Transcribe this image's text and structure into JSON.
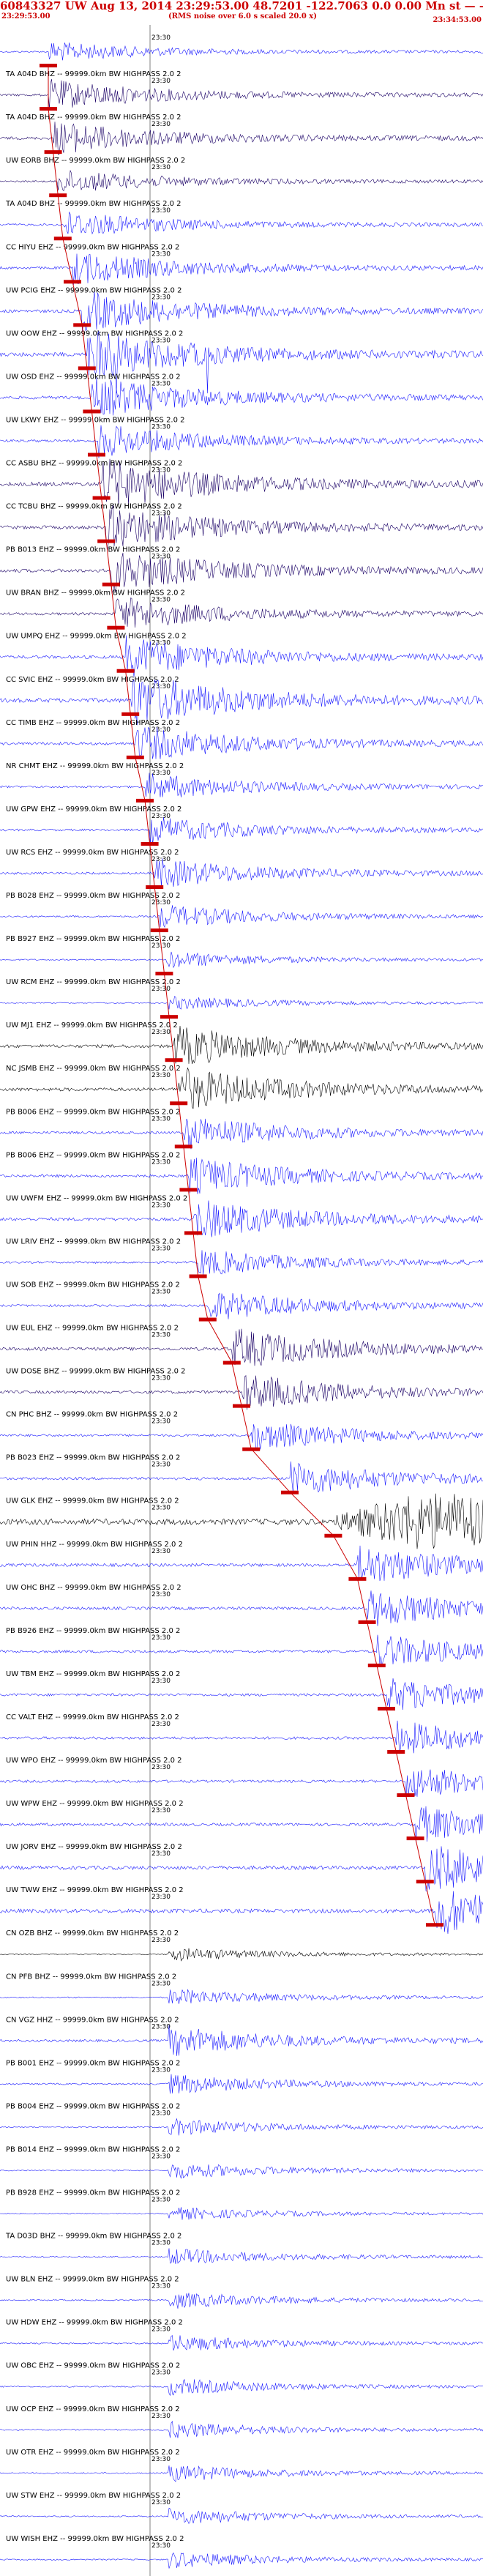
{
  "header": {
    "title": "60843327 UW Aug 13, 2014 23:29:53.00   48.7201  -122.7063   0.0 0.00  Mn st — — — — -1",
    "start_time": "23:29:53.00",
    "note": "(RMS noise over 6.0 s scaled 20.0 x)",
    "end_time": "23:34:53.00"
  },
  "time_mark": "23:30",
  "colors": {
    "accent": "#cc0000",
    "trace_blue": "#1a1aff",
    "trace_dark": "#1a0066",
    "trace_black": "#000000"
  },
  "traces": [
    {
      "label": "",
      "color": "blue",
      "amp": 0.6,
      "pick": 0.1
    },
    {
      "label": "TA A04D BHZ -- 99999.0km BW  HIGHPASS  2.0  2",
      "color": "dark",
      "amp": 0.9,
      "pick": 0.1
    },
    {
      "label": "TA A04D BHZ -- 99999.0km BW  HIGHPASS  2.0  2",
      "color": "dark",
      "amp": 1.0,
      "pick": 0.11
    },
    {
      "label": "UW EORB BHZ -- 99999.0km BW  HIGHPASS  2.0  2",
      "color": "dark",
      "amp": 0.7,
      "pick": 0.12
    },
    {
      "label": "TA A04D BHZ -- 99999.0km BW  HIGHPASS  2.0  2",
      "color": "blue",
      "amp": 0.8,
      "pick": 0.13
    },
    {
      "label": "CC HIYU EHZ -- 99999.0km BW  HIGHPASS  2.0  2",
      "color": "blue",
      "amp": 1.0,
      "pick": 0.15
    },
    {
      "label": "UW PCIG EHZ -- 99999.0km BW  HIGHPASS  2.0  2",
      "color": "blue",
      "amp": 1.2,
      "pick": 0.17
    },
    {
      "label": "UW OOW EHZ -- 99999.0km BW  HIGHPASS  2.0  2",
      "color": "blue",
      "amp": 1.5,
      "pick": 0.18,
      "spikes": true
    },
    {
      "label": "UW OSD EHZ -- 99999.0km BW  HIGHPASS  2.0  2",
      "color": "blue",
      "amp": 1.2,
      "pick": 0.19
    },
    {
      "label": "UW LKWY EHZ -- 99999.0km BW  HIGHPASS  2.0  2",
      "color": "blue",
      "amp": 1.0,
      "pick": 0.2
    },
    {
      "label": "CC ASBU BHZ -- 99999.0km BW  HIGHPASS  2.0  2",
      "color": "dark",
      "amp": 1.5,
      "pick": 0.21
    },
    {
      "label": "CC TCBU BHZ -- 99999.0km BW  HIGHPASS  2.0  2",
      "color": "dark",
      "amp": 1.3,
      "pick": 0.22
    },
    {
      "label": "PB B013 EHZ -- 99999.0km BW  HIGHPASS  2.0  2",
      "color": "dark",
      "amp": 1.3,
      "pick": 0.23
    },
    {
      "label": "UW BRAN BHZ -- 99999.0km BW  HIGHPASS  2.0  2",
      "color": "dark",
      "amp": 1.0,
      "pick": 0.24
    },
    {
      "label": "UW UMPQ EHZ -- 99999.0km BW  HIGHPASS  2.0  2",
      "color": "blue",
      "amp": 1.2,
      "pick": 0.26
    },
    {
      "label": "CC SVIC EHZ -- 99999.0km BW  HIGHPASS  2.0  2",
      "color": "blue",
      "amp": 1.6,
      "pick": 0.27
    },
    {
      "label": "CC TIMB EHZ -- 99999.0km BW  HIGHPASS  2.0  2",
      "color": "blue",
      "amp": 1.1,
      "pick": 0.28
    },
    {
      "label": "NR CHMT EHZ -- 99999.0km BW  HIGHPASS  2.0  2",
      "color": "blue",
      "amp": 0.8,
      "pick": 0.3
    },
    {
      "label": "UW GPW EHZ -- 99999.0km BW  HIGHPASS  2.0  2",
      "color": "blue",
      "amp": 0.8,
      "pick": 0.31
    },
    {
      "label": "UW RCS EHZ -- 99999.0km BW  HIGHPASS  2.0  2",
      "color": "blue",
      "amp": 0.9,
      "pick": 0.32
    },
    {
      "label": "PB B028 EHZ -- 99999.0km BW  HIGHPASS  2.0  2",
      "color": "blue",
      "amp": 0.7,
      "pick": 0.33
    },
    {
      "label": "PB B927 EHZ -- 99999.0km BW  HIGHPASS  2.0  2",
      "color": "blue",
      "amp": 0.5,
      "pick": 0.34
    },
    {
      "label": "UW RCM EHZ -- 99999.0km BW  HIGHPASS  2.0  2",
      "color": "blue",
      "amp": 0.4,
      "pick": 0.35
    },
    {
      "label": "UW MJ1 EHZ -- 99999.0km BW  HIGHPASS  2.0  2",
      "color": "black",
      "amp": 1.2,
      "pick": 0.36
    },
    {
      "label": "NC JSMB EHZ -- 99999.0km BW  HIGHPASS  2.0  2",
      "color": "black",
      "amp": 1.3,
      "pick": 0.37
    },
    {
      "label": "PB B006 EHZ -- 99999.0km BW  HIGHPASS  2.0  2",
      "color": "blue",
      "amp": 1.0,
      "pick": 0.38
    },
    {
      "label": "PB B006 EHZ -- 99999.0km BW  HIGHPASS  2.0  2",
      "color": "blue",
      "amp": 1.1,
      "pick": 0.39
    },
    {
      "label": "UW UWFM EHZ -- 99999.0km BW  HIGHPASS  2.0  2",
      "color": "blue",
      "amp": 1.2,
      "pick": 0.4
    },
    {
      "label": "UW LRIV EHZ -- 99999.0km BW  HIGHPASS  2.0  2",
      "color": "blue",
      "amp": 0.8,
      "pick": 0.41
    },
    {
      "label": "UW SOB EHZ -- 99999.0km BW  HIGHPASS  2.0  2",
      "color": "blue",
      "amp": 0.9,
      "pick": 0.43
    },
    {
      "label": "UW EUL EHZ -- 99999.0km BW  HIGHPASS  2.0  2",
      "color": "dark",
      "amp": 1.2,
      "pick": 0.48
    },
    {
      "label": "UW DOSE BHZ -- 99999.0km BW  HIGHPASS  2.0  2",
      "color": "dark",
      "amp": 1.1,
      "pick": 0.5
    },
    {
      "label": "CN PHC BHZ -- 99999.0km BW  HIGHPASS  2.0  2",
      "color": "blue",
      "amp": 0.9,
      "pick": 0.52
    },
    {
      "label": "PB B023 EHZ -- 99999.0km BW  HIGHPASS  2.0  2",
      "color": "blue",
      "amp": 1.0,
      "pick": 0.6
    },
    {
      "label": "UW GLK EHZ -- 99999.0km BW  HIGHPASS  2.0  2",
      "color": "black",
      "amp": 2.2,
      "pick": 0.69,
      "burst": true
    },
    {
      "label": "UW PHIN HHZ -- 99999.0km BW  HIGHPASS  2.0  2",
      "color": "blue",
      "amp": 1.2,
      "pick": 0.74
    },
    {
      "label": "UW OHC BHZ -- 99999.0km BW  HIGHPASS  2.0  2",
      "color": "blue",
      "amp": 1.1,
      "pick": 0.76
    },
    {
      "label": "PB B926 EHZ -- 99999.0km BW  HIGHPASS  2.0  2",
      "color": "blue",
      "amp": 1.0,
      "pick": 0.78
    },
    {
      "label": "UW TBM EHZ -- 99999.0km BW  HIGHPASS  2.0  2",
      "color": "blue",
      "amp": 1.0,
      "pick": 0.8
    },
    {
      "label": "CC VALT EHZ -- 99999.0km BW  HIGHPASS  2.0  2",
      "color": "blue",
      "amp": 1.0,
      "pick": 0.82
    },
    {
      "label": "UW WPO EHZ -- 99999.0km BW  HIGHPASS  2.0  2",
      "color": "blue",
      "amp": 1.0,
      "pick": 0.84
    },
    {
      "label": "UW WPW EHZ -- 99999.0km BW  HIGHPASS  2.0  2",
      "color": "blue",
      "amp": 1.1,
      "pick": 0.86
    },
    {
      "label": "UW JORV EHZ -- 99999.0km BW  HIGHPASS  2.0  2",
      "color": "blue",
      "amp": 1.4,
      "pick": 0.88
    },
    {
      "label": "UW TWW EHZ -- 99999.0km BW  HIGHPASS  2.0  2",
      "color": "blue",
      "amp": 1.5,
      "pick": 0.9
    },
    {
      "label": "CN OZB BHZ -- 99999.0km BW  HIGHPASS  2.0  2",
      "color": "black",
      "amp": 0.4,
      "pick": null
    },
    {
      "label": "CN PFB BHZ -- 99999.0km BW  HIGHPASS  2.0  2",
      "color": "blue",
      "amp": 0.5,
      "pick": null
    },
    {
      "label": "CN VGZ HHZ -- 99999.0km BW  HIGHPASS  2.0  2",
      "color": "blue",
      "amp": 0.9,
      "pick": null
    },
    {
      "label": "PB B001 EHZ -- 99999.0km BW  HIGHPASS  2.0  2",
      "color": "blue",
      "amp": 0.6,
      "pick": null
    },
    {
      "label": "PB B004 EHZ -- 99999.0km BW  HIGHPASS  2.0  2",
      "color": "blue",
      "amp": 0.5,
      "pick": null
    },
    {
      "label": "PB B014 EHZ -- 99999.0km BW  HIGHPASS  2.0  2",
      "color": "blue",
      "amp": 0.5,
      "pick": null
    },
    {
      "label": "PB B928 EHZ -- 99999.0km BW  HIGHPASS  2.0  2",
      "color": "blue",
      "amp": 0.4,
      "pick": null
    },
    {
      "label": "TA D03D BHZ -- 99999.0km BW  HIGHPASS  2.0  2",
      "color": "blue",
      "amp": 0.5,
      "pick": null
    },
    {
      "label": "UW BLN EHZ -- 99999.0km BW  HIGHPASS  2.0  2",
      "color": "blue",
      "amp": 0.5,
      "pick": null
    },
    {
      "label": "UW HDW EHZ -- 99999.0km BW  HIGHPASS  2.0  2",
      "color": "blue",
      "amp": 0.5,
      "pick": null
    },
    {
      "label": "UW OBC EHZ -- 99999.0km BW  HIGHPASS  2.0  2",
      "color": "blue",
      "amp": 0.5,
      "pick": null
    },
    {
      "label": "UW OCP EHZ -- 99999.0km BW  HIGHPASS  2.0  2",
      "color": "blue",
      "amp": 0.5,
      "pick": null
    },
    {
      "label": "UW OTR EHZ -- 99999.0km BW  HIGHPASS  2.0  2",
      "color": "blue",
      "amp": 0.5,
      "pick": null
    },
    {
      "label": "UW STW EHZ -- 99999.0km BW  HIGHPASS  2.0  2",
      "color": "blue",
      "amp": 0.5,
      "pick": null
    },
    {
      "label": "UW WISH EHZ -- 99999.0km BW  HIGHPASS  2.0  2",
      "color": "blue",
      "amp": 0.5,
      "pick": null
    }
  ]
}
